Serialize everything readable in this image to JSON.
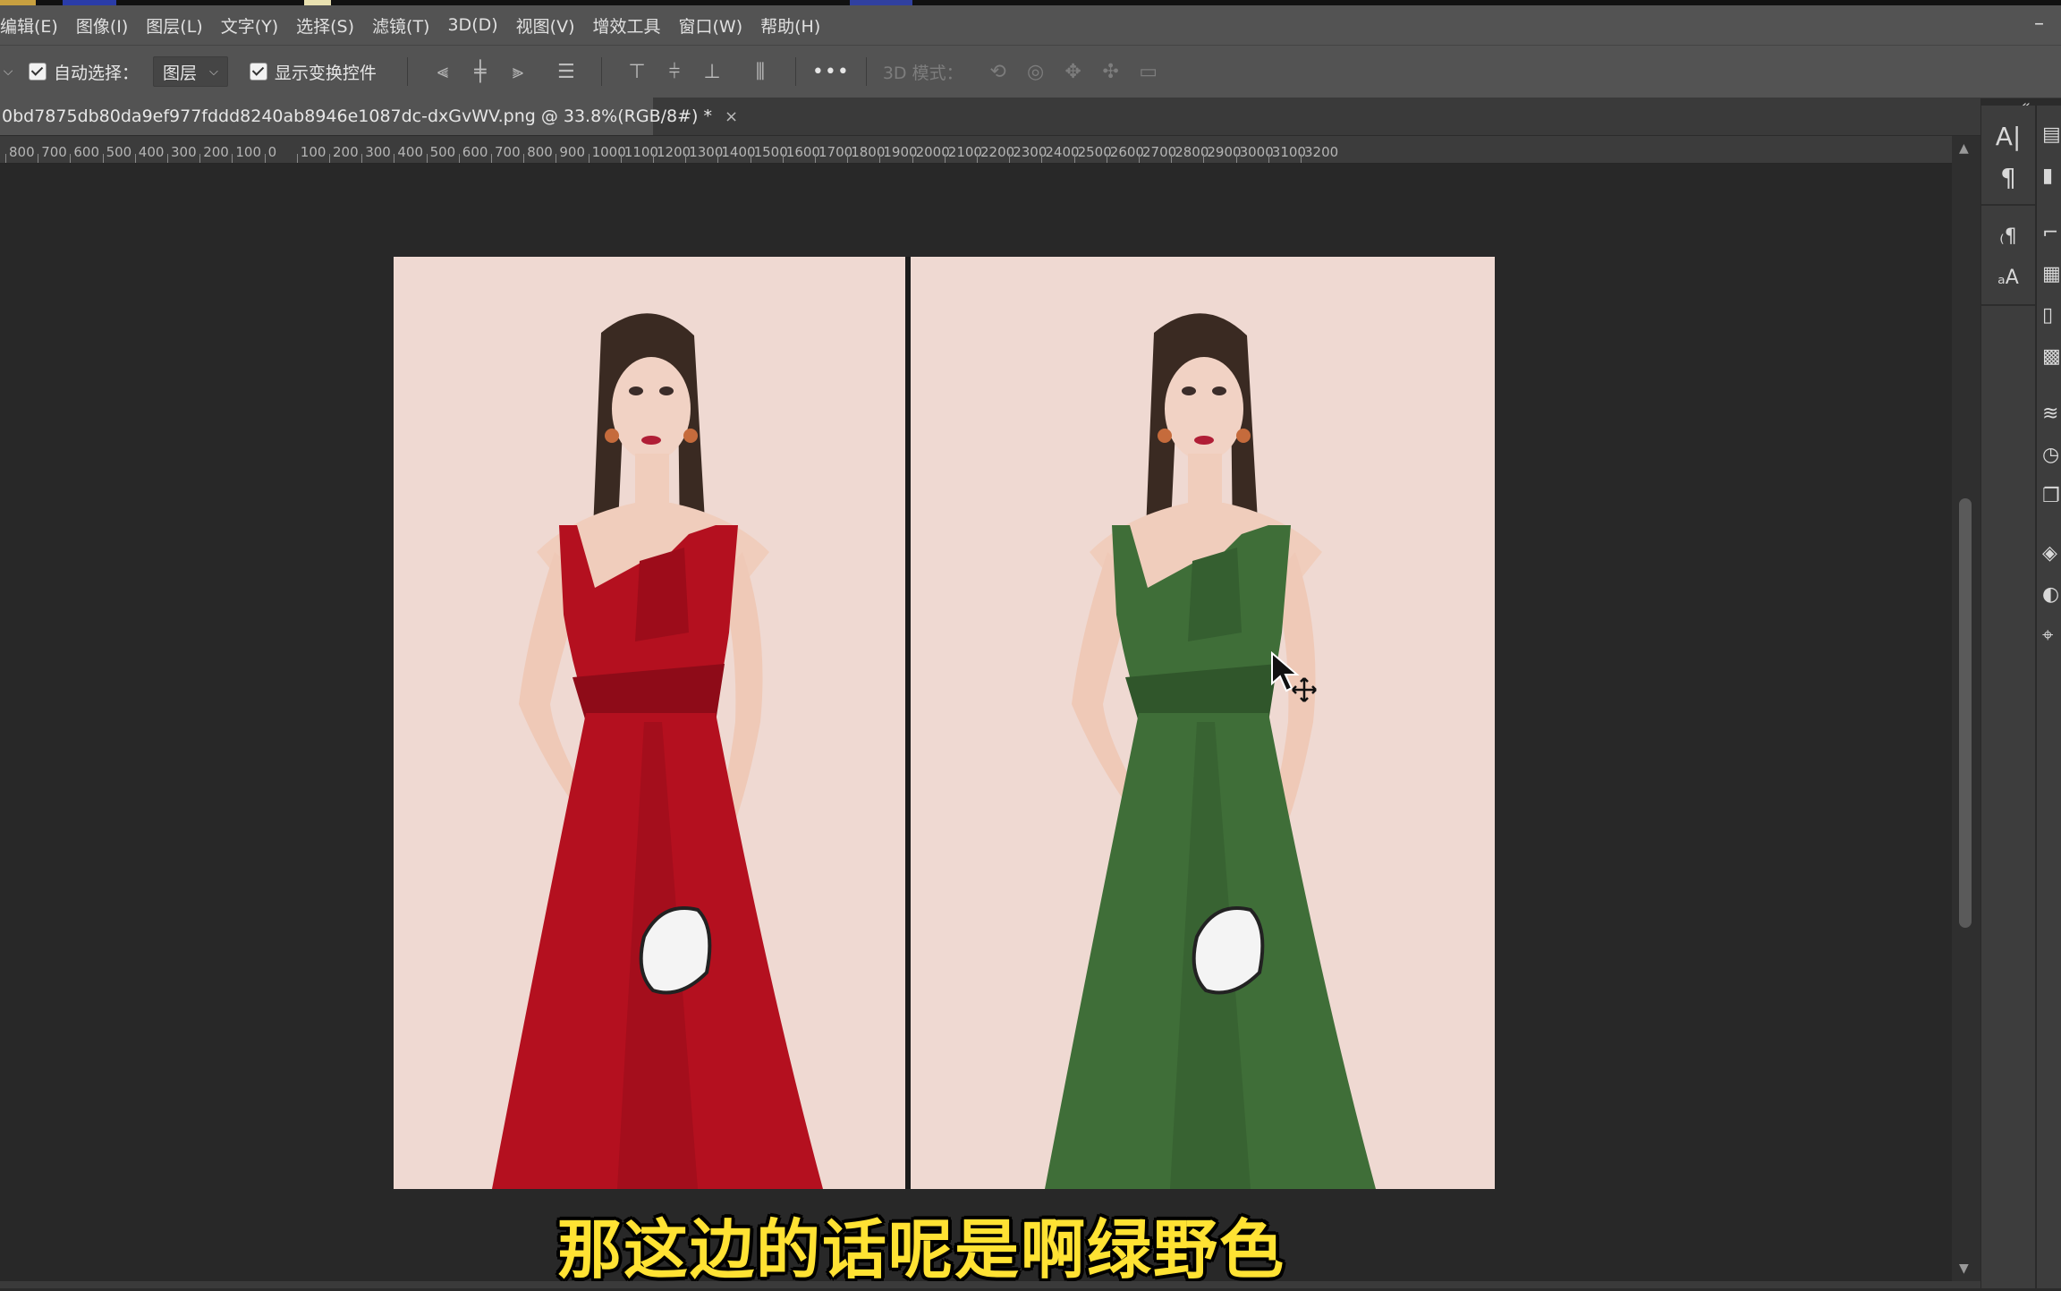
{
  "menu": {
    "items": [
      "编辑(E)",
      "图像(I)",
      "图层(L)",
      "文字(Y)",
      "选择(S)",
      "滤镜(T)",
      "3D(D)",
      "视图(V)",
      "增效工具",
      "窗口(W)",
      "帮助(H)"
    ]
  },
  "options": {
    "auto_select_label": "自动选择：",
    "auto_select_value": "图层",
    "show_transform_label": "显示变换控件",
    "more_label": "•••",
    "mode_3d_label": "3D 模式："
  },
  "document": {
    "tab_title": "0bd7875db80da9ef977fddd8240ab8946e1087dc-dxGvWV.png @ 33.8%(RGB/8#) *",
    "close_glyph": "×"
  },
  "ruler": {
    "labels": [
      "800",
      "700",
      "600",
      "500",
      "400",
      "300",
      "200",
      "100",
      "0",
      "100",
      "200",
      "300",
      "400",
      "500",
      "600",
      "700",
      "800",
      "900",
      "1000",
      "1100",
      "1200",
      "1300",
      "1400",
      "1500",
      "1600",
      "1700",
      "1800",
      "1900",
      "2000",
      "2100",
      "2200",
      "2300",
      "2400",
      "2500",
      "2600",
      "2700",
      "2800",
      "2900",
      "3000",
      "3100",
      "3200"
    ]
  },
  "caption": {
    "text": "那这边的话呢是啊绿野色"
  },
  "photos": {
    "left_dress_color": "#b4101f",
    "right_dress_color": "#3f6e38",
    "background_color": "#efd9d2"
  },
  "panel": {
    "collapse_glyph": "«",
    "tools": [
      "A|",
      "¶",
      "₍¶",
      "ₐA"
    ]
  }
}
